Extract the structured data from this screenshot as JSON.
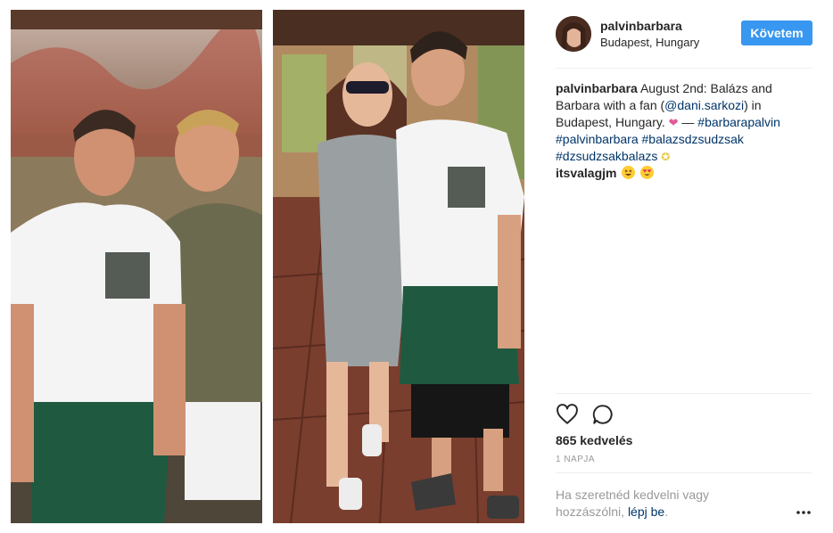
{
  "post": {
    "username": "palvinbarbara",
    "location": "Budapest, Hungary",
    "follow_label": "Követem",
    "caption": {
      "username": "palvinbarbara",
      "text_1": " August 2nd: Balázs and Barbara with a fan (",
      "mention": "@dani.sarkozi",
      "text_2": ") in Budapest, Hungary. ",
      "dash": " — ",
      "tag_1": "#barbarapalvin",
      "tag_2": "#palvinbarbara",
      "tag_3": "#balazsdzsudzsak",
      "tag_4": "#dzsudzsakbalazs"
    },
    "comment": {
      "username": "itsvalagjm"
    },
    "likes": "865 kedvelés",
    "time": "1 NAPJA",
    "login_prompt": {
      "text": "Ha szeretnéd kedvelni vagy hozzászólni, ",
      "link": "lépj be",
      "end": "."
    },
    "icons": {
      "like": "heart-icon",
      "comment": "comment-icon",
      "more": "more-options-icon"
    },
    "colors": {
      "follow": "#3897f0",
      "link": "#003569",
      "muted": "#999999"
    }
  }
}
